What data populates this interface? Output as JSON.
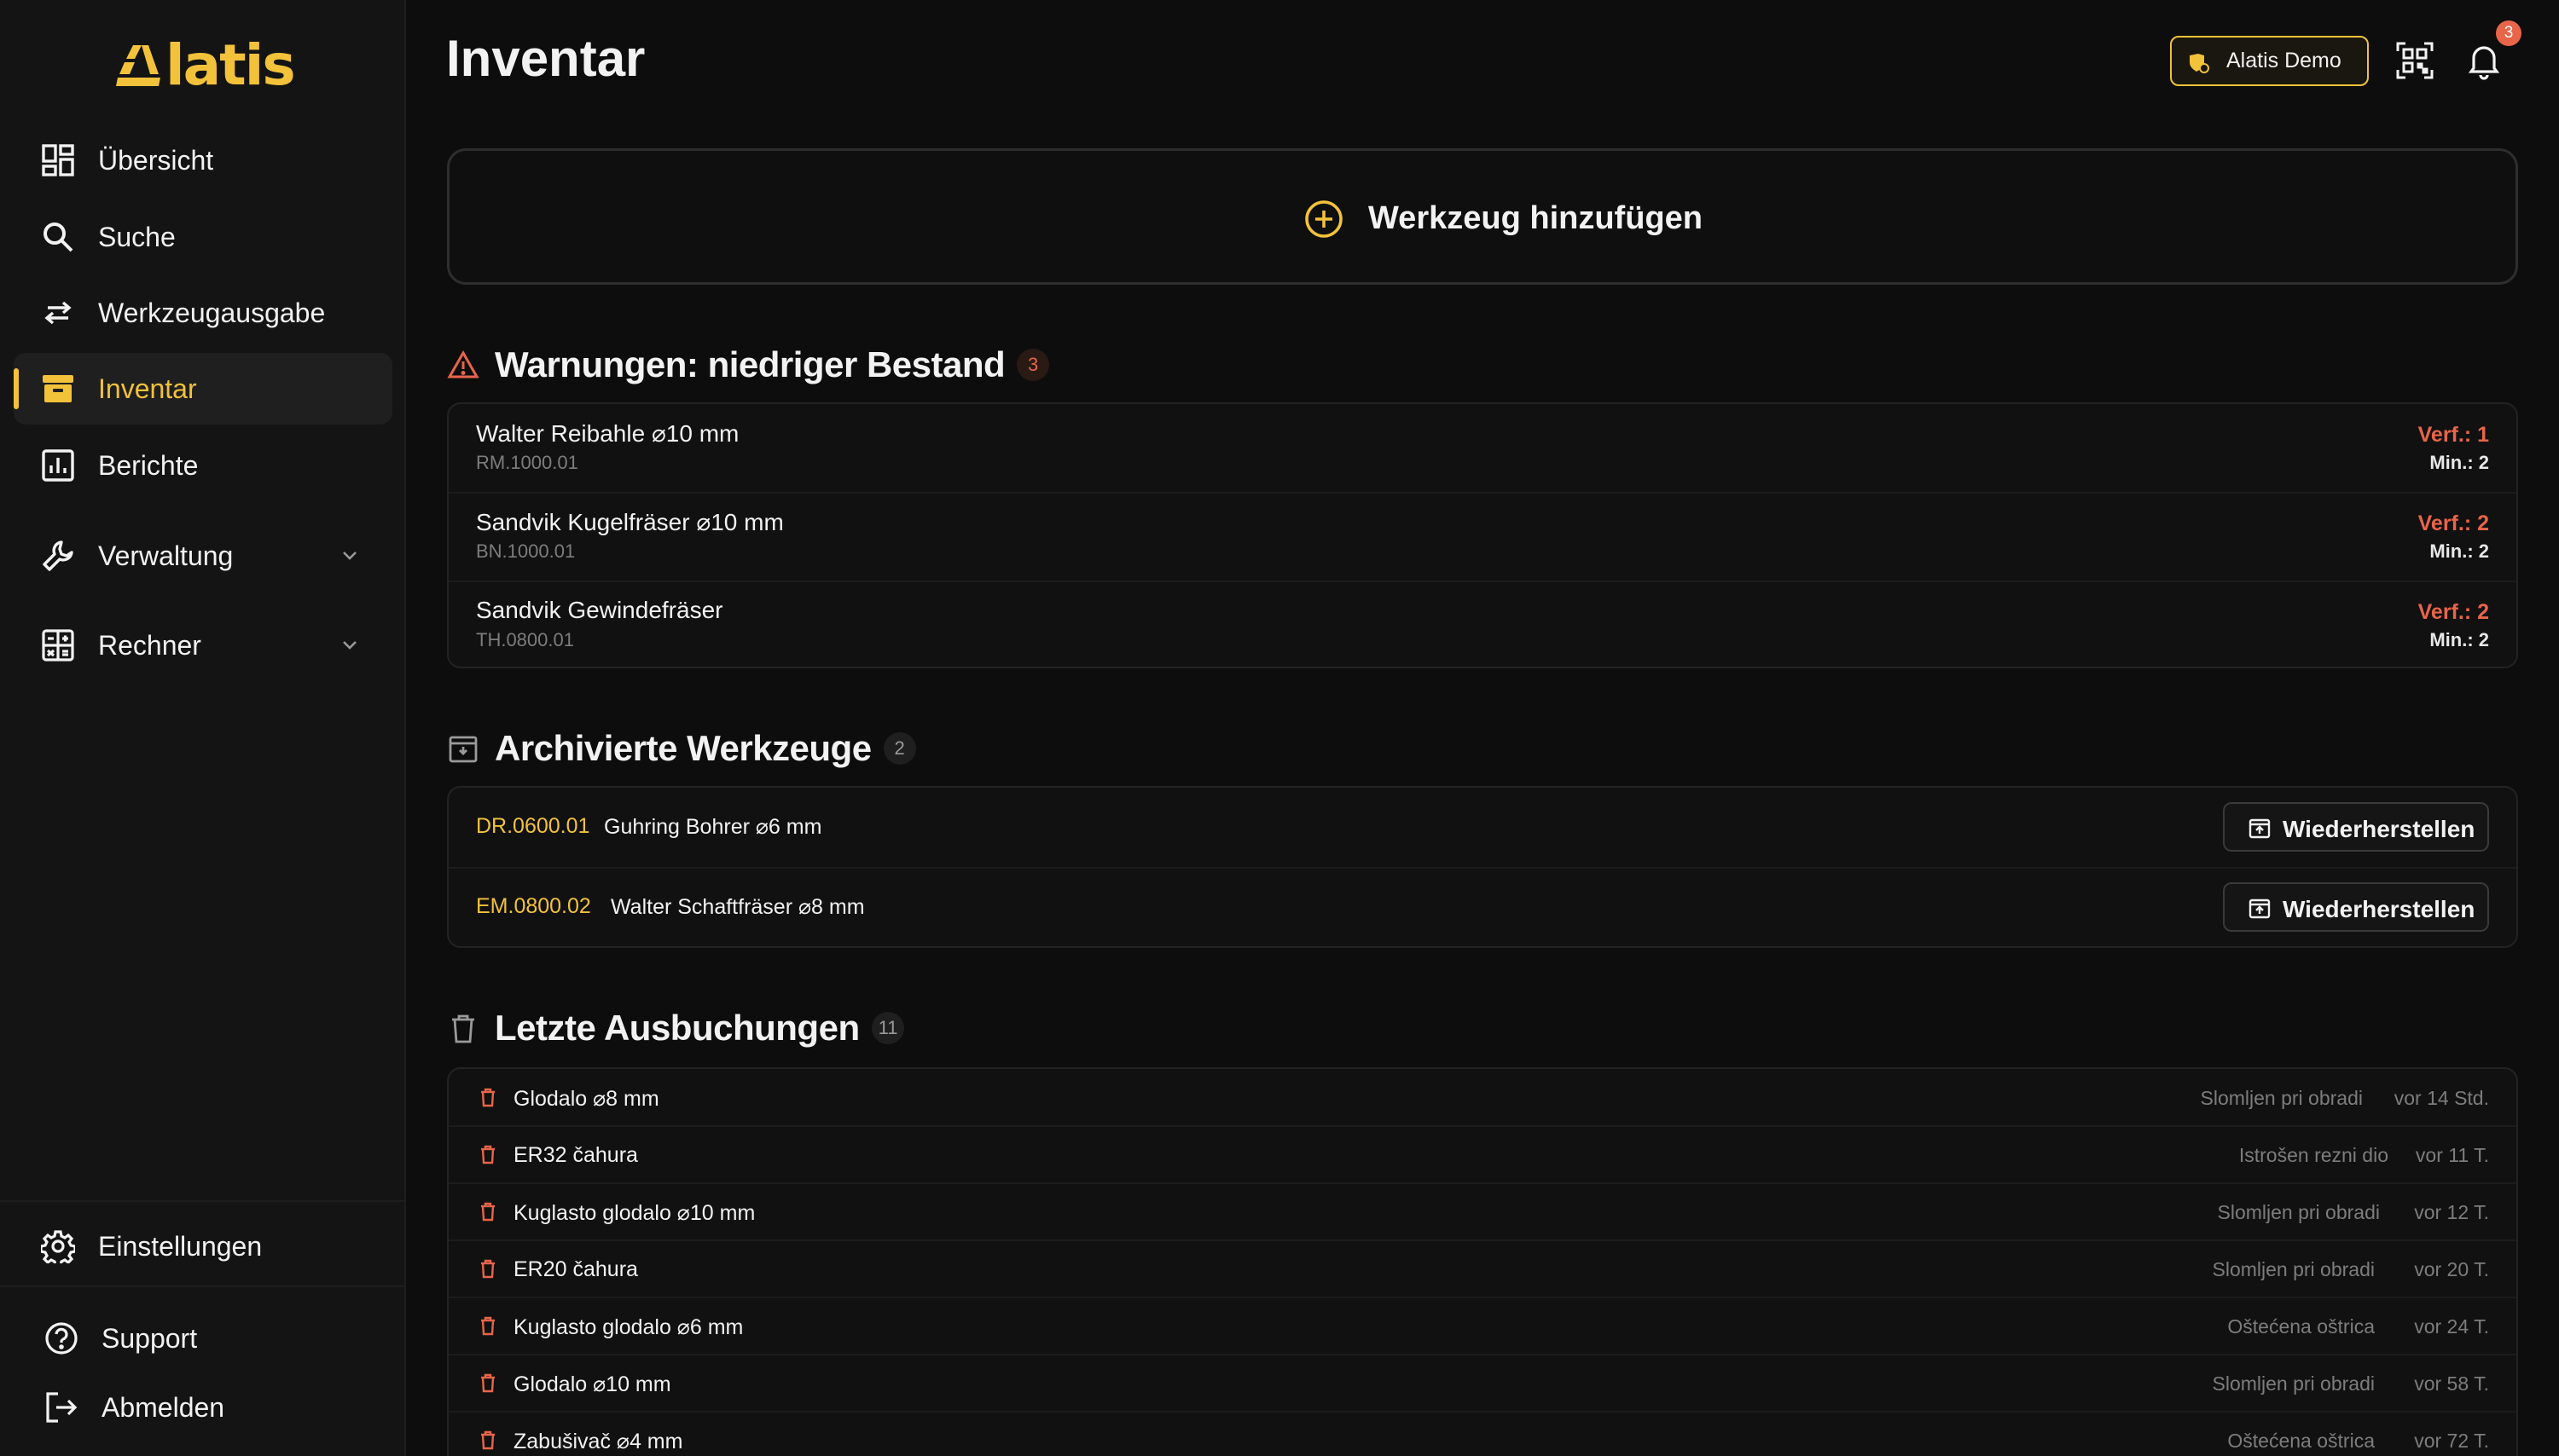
{
  "app": {
    "logo_text": "latis",
    "brand_color": "#f2c23a",
    "warning_color": "#e8654a"
  },
  "sidebar": {
    "items": [
      {
        "label": "Übersicht",
        "icon": "dashboard-icon"
      },
      {
        "label": "Suche",
        "icon": "search-icon"
      },
      {
        "label": "Werkzeugausgabe",
        "icon": "swap-arrows-icon"
      },
      {
        "label": "Inventar",
        "icon": "archive-box-icon",
        "active": true
      },
      {
        "label": "Berichte",
        "icon": "bar-chart-icon"
      },
      {
        "label": "Verwaltung",
        "icon": "wrench-icon",
        "expandable": true
      },
      {
        "label": "Rechner",
        "icon": "calculator-icon",
        "expandable": true
      }
    ],
    "settings_label": "Einstellungen",
    "support_label": "Support",
    "logout_label": "Abmelden"
  },
  "header": {
    "title": "Inventar",
    "workspace_label": "Alatis Demo",
    "notification_count": "3"
  },
  "add_tool": {
    "label": "Werkzeug hinzufügen"
  },
  "warnings": {
    "title": "Warnungen: niedriger Bestand",
    "count": "3",
    "items": [
      {
        "name": "Walter Reibahle ⌀10 mm",
        "code": "RM.1000.01",
        "available": "Verf.: 1",
        "minimum": "Min.: 2"
      },
      {
        "name": "Sandvik Kugelfräser ⌀10 mm",
        "code": "BN.1000.01",
        "available": "Verf.: 2",
        "minimum": "Min.: 2"
      },
      {
        "name": "Sandvik Gewindefräser",
        "code": "TH.0800.01",
        "available": "Verf.: 2",
        "minimum": "Min.: 2"
      }
    ]
  },
  "archived": {
    "title": "Archivierte Werkzeuge",
    "count": "2",
    "restore_label": "Wiederherstellen",
    "items": [
      {
        "code": "DR.0600.01",
        "name": "Guhring Bohrer ⌀6 mm"
      },
      {
        "code": "EM.0800.02",
        "name": "Walter Schaftfräser ⌀8 mm"
      }
    ]
  },
  "last_checkouts": {
    "title": "Letzte Ausbuchungen",
    "count": "11",
    "items": [
      {
        "name": "Glodalo ⌀8 mm",
        "reason": "Slomljen pri obradi",
        "time": "vor 14 Std."
      },
      {
        "name": "ER32 čahura",
        "reason": "Istrošen rezni dio",
        "time": "vor 11 T."
      },
      {
        "name": "Kuglasto glodalo ⌀10 mm",
        "reason": "Slomljen pri obradi",
        "time": "vor 12 T."
      },
      {
        "name": "ER20 čahura",
        "reason": "Slomljen pri obradi",
        "time": "vor 20 T."
      },
      {
        "name": "Kuglasto glodalo ⌀6 mm",
        "reason": "Oštećena oštrica",
        "time": "vor 24 T."
      },
      {
        "name": "Glodalo ⌀10 mm",
        "reason": "Slomljen pri obradi",
        "time": "vor 58 T."
      },
      {
        "name": "Zabušivač ⌀4 mm",
        "reason": "Oštećena oštrica",
        "time": "vor 72 T."
      }
    ]
  }
}
